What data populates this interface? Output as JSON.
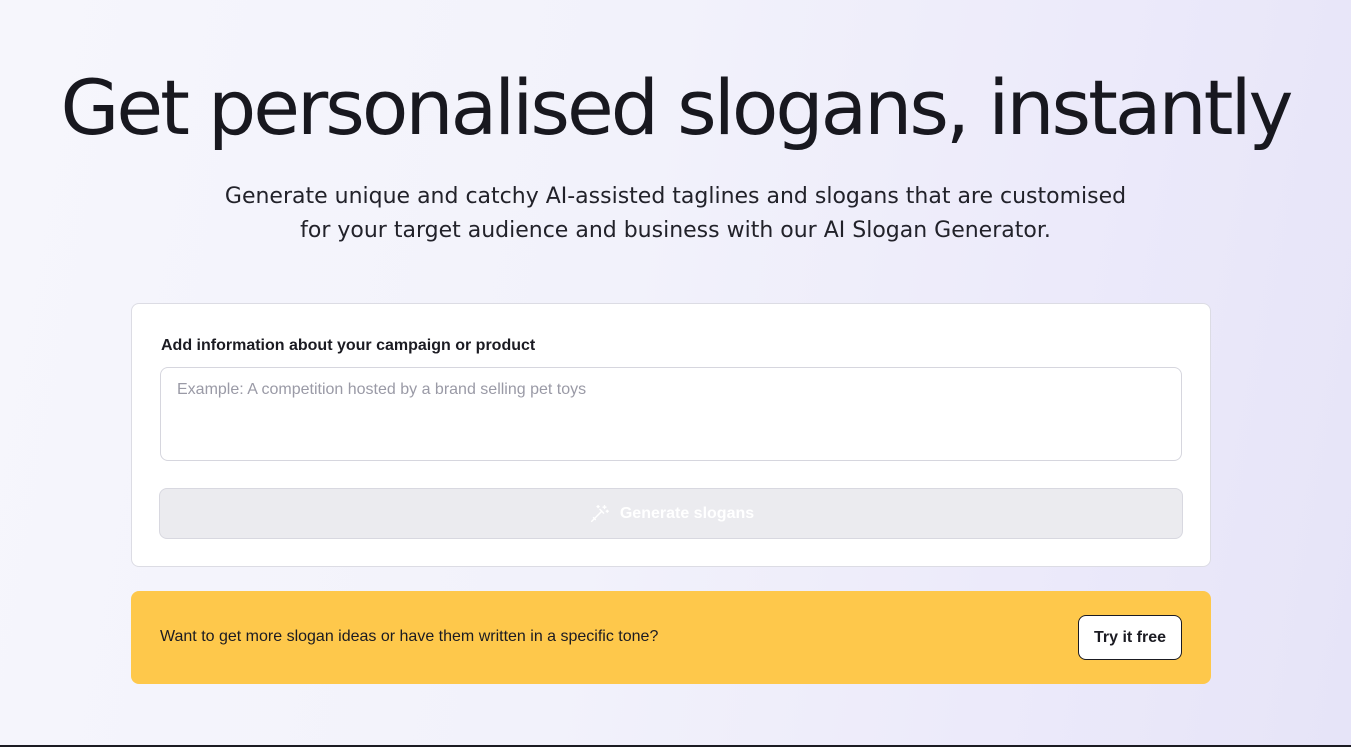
{
  "hero": {
    "title": "Get personalised slogans, instantly",
    "subtitle_line1": "Generate unique and catchy AI-assisted taglines and slogans that are customised",
    "subtitle_line2": "for your target audience and business with our AI Slogan Generator."
  },
  "form": {
    "label": "Add information about your campaign or product",
    "placeholder": "Example: A competition hosted by a brand selling pet toys",
    "value": "",
    "generate_label": "Generate slogans",
    "generate_icon": "magic-wand-icon"
  },
  "promo": {
    "text": "Want to get more slogan ideas or have them written in a specific tone?",
    "button_label": "Try it free"
  },
  "colors": {
    "accent": "#fec84b",
    "text": "#1b1b22",
    "disabled_button_bg": "#ebebef",
    "placeholder": "#9a9aa6"
  }
}
